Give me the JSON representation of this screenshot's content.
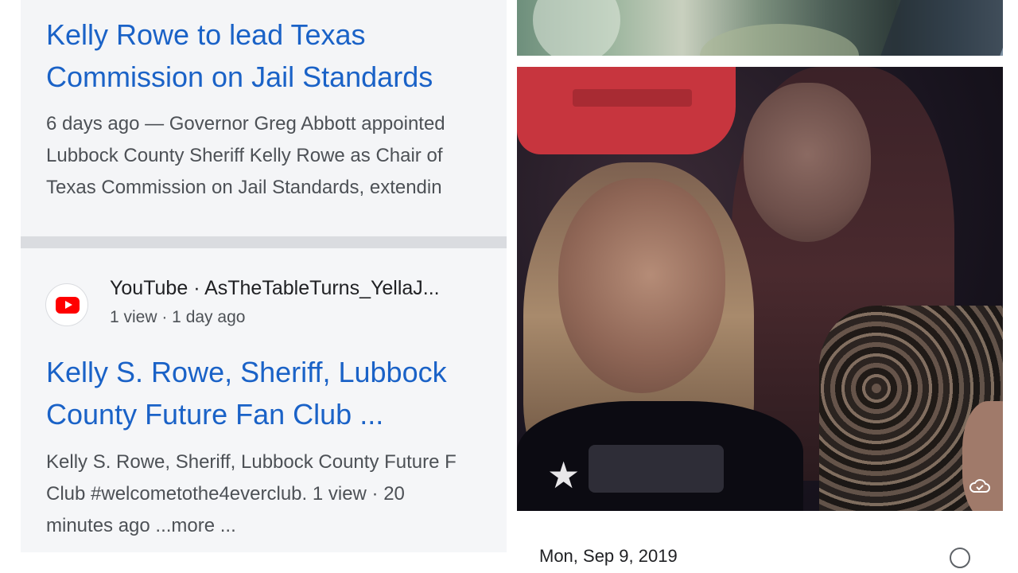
{
  "results": [
    {
      "title_lines": [
        "Kelly Rowe to lead Texas",
        "Commission on Jail Standards"
      ],
      "snippet_lines": [
        "6 days ago — Governor Greg Abbott appointed",
        "Lubbock County Sheriff Kelly Rowe as Chair of",
        "Texas Commission on Jail Standards, extendin"
      ]
    },
    {
      "source_name": "YouTube · AsTheTableTurns_YellaJ...",
      "source_meta": "1 view · 1 day ago",
      "title_lines": [
        "Kelly S. Rowe, Sheriff, Lubbock",
        "County Future Fan Club ..."
      ],
      "snippet_lines": [
        "Kelly S. Rowe, Sheriff, Lubbock County Future F",
        "Club #welcometothe4everclub. 1 view · 20",
        "minutes ago ...more ..."
      ]
    }
  ],
  "photos": {
    "footer_date": "Mon, Sep 9, 2019",
    "icons": [
      "star-icon",
      "cloud-icon",
      "edit-icon"
    ]
  },
  "colors": {
    "link_blue": "#1a62c7",
    "snippet_gray": "#4d5156",
    "youtube_red": "#ff0000"
  }
}
